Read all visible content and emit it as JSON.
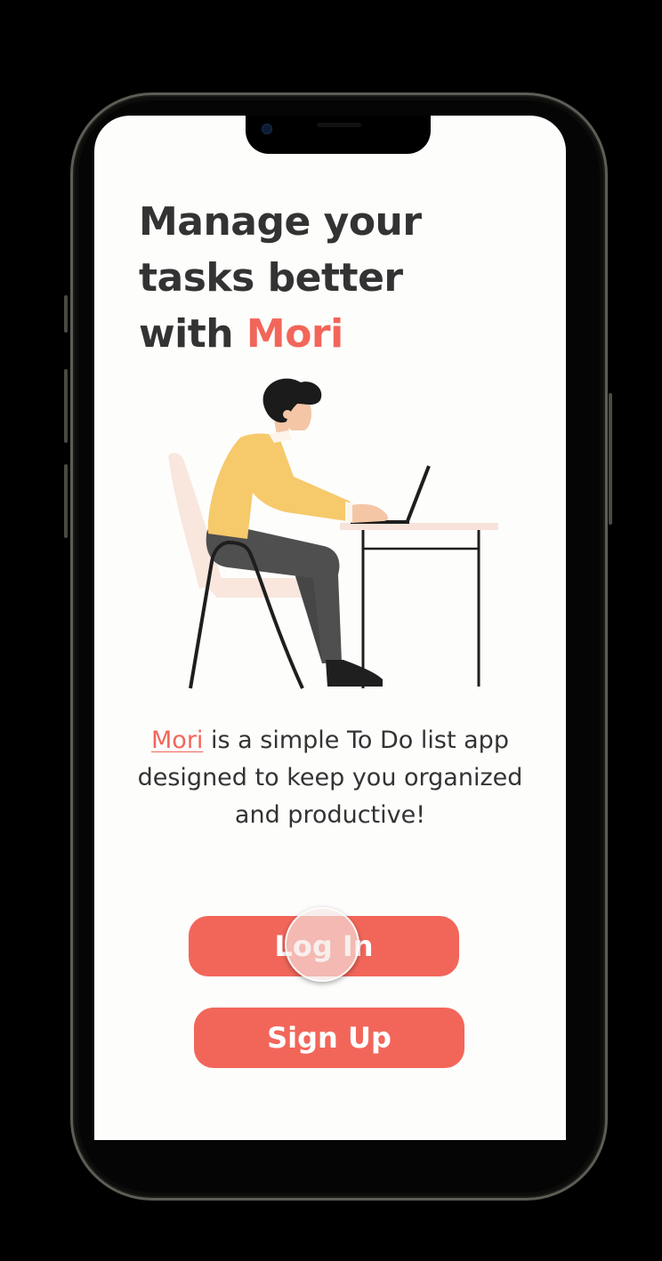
{
  "onboarding": {
    "headline_line1": "Manage your",
    "headline_line2": "tasks better",
    "headline_line3_prefix": "with ",
    "headline_brand": "Mori",
    "description_brand": "Mori",
    "description_rest": " is a simple To Do list app designed to keep you organized and productive!"
  },
  "actions": {
    "login_label": "Log In",
    "signup_label": "Sign Up"
  },
  "illustration": {
    "icon": "person-working-on-laptop-illustration"
  },
  "colors": {
    "accent": "#f2665a",
    "text": "#333333",
    "background": "#fdfdfc",
    "shirt": "#f6c96b",
    "pants": "#4f4f4f",
    "hair": "#1b1b1b"
  }
}
